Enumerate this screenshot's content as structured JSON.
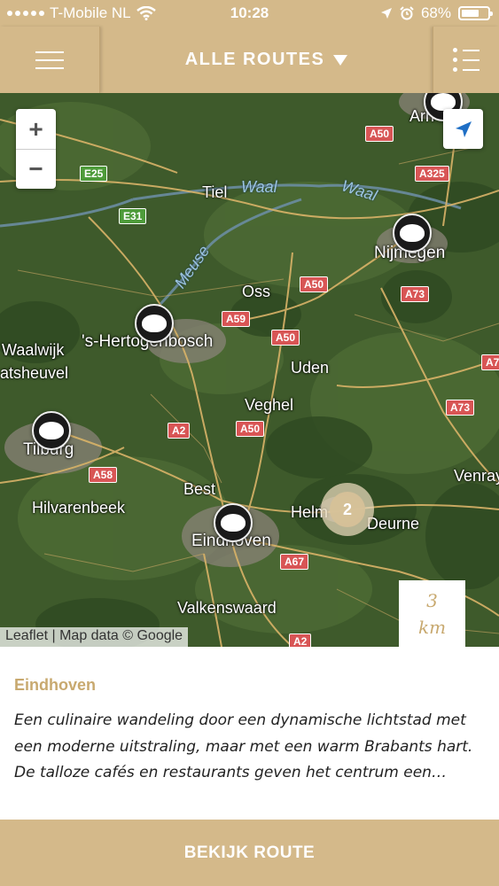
{
  "status_bar": {
    "carrier": "T-Mobile NL",
    "time": "10:28",
    "battery": "68%",
    "battery_level": 0.68
  },
  "header": {
    "title": "ALLE ROUTES"
  },
  "map": {
    "zoom_in": "+",
    "zoom_out": "−",
    "attribution": "Leaflet | Map data © Google",
    "scale_value": "3",
    "scale_unit": "km",
    "cluster_count": "2",
    "places": {
      "arnhem": "Arn",
      "tiel": "Tiel",
      "nijmegen": "Nijmegen",
      "oss": "Oss",
      "denbosch": "'s-Hertogenbosch",
      "waalwijk": "Waalwijk",
      "kaatsheuvel": "atsheuvel",
      "uden": "Uden",
      "veghel": "Veghel",
      "tilburg": "Tilburg",
      "best": "Best",
      "helmond": "Helm",
      "deurne": "Deurne",
      "venray": "Venray",
      "hilvarenbeek": "Hilvarenbeek",
      "eindhoven": "Eindhoven",
      "valkenswaard": "Valkenswaard"
    },
    "water": {
      "waal1": "Waal",
      "waal2": "Waal",
      "meuse": "Meuse"
    },
    "roads": {
      "a50_1": "A50",
      "a325": "A325",
      "e25": "E25",
      "e31": "E31",
      "a50_2": "A50",
      "a73_1": "A73",
      "a59": "A59",
      "a50_3": "A50",
      "a7": "A7",
      "a73_2": "A73",
      "a2_1": "A2",
      "a50_4": "A50",
      "a58": "A58",
      "a67": "A67",
      "a2_2": "A2"
    }
  },
  "route": {
    "title": "Eindhoven",
    "description": "Een culinaire wandeling door een dynamische lichtstad met een moderne uitstraling, maar met een warm Brabants hart. De talloze cafés en restaurants geven het centrum een…"
  },
  "cta": {
    "label": "BEKIJK ROUTE"
  },
  "colors": {
    "brand": "#d4b98a",
    "accent": "#c8a96f",
    "locate": "#1f6fc5"
  }
}
